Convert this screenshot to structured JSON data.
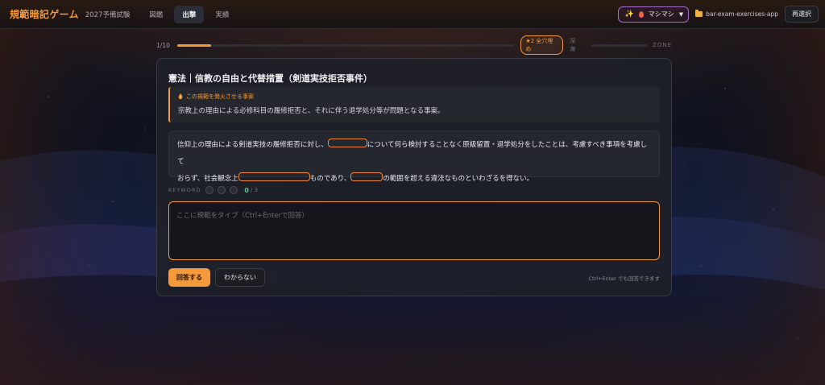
{
  "header": {
    "logo": "規範暗記ゲーム",
    "exam": "2027予備試験",
    "tabs": [
      {
        "label": "図鑑",
        "active": false
      },
      {
        "label": "出撃",
        "active": true
      },
      {
        "label": "実績",
        "active": false
      }
    ],
    "mode": "マシマシ",
    "repo": "bar-exam-exercises-app",
    "reselect": "再選択"
  },
  "progress": {
    "count": "1/10",
    "fraction": 0.1,
    "streak": "★2 全穴埋め",
    "depth": "深 海",
    "zone": "ZONE"
  },
  "question": {
    "title": "憲法｜信教の自由と代替措置（剣道実技拒否事件）",
    "facts_label": "この規範を発火させる事案",
    "facts_text": "宗教上の理由による必修科目の履修拒否と、それに伴う退学処分等が問題となる事案。",
    "segments": [
      "信仰上の理由による剣道実技の履修拒否に対し、",
      "について何ら検討することなく原級留置・退学処分をしたことは、考慮すべき事項を考慮して",
      "おらず、社会観念上",
      "ものであり、",
      "の範囲を超える違法なものといわざるを得ない。"
    ]
  },
  "keyword": {
    "label": "KEYWORD",
    "count": "0",
    "total": "/ 3"
  },
  "answer": {
    "placeholder": "ここに規範をタイプ（Ctrl+Enterで回答）",
    "value": ""
  },
  "actions": {
    "submit": "回答する",
    "unknown": "わからない",
    "hint": "Ctrl+Enter でも回答できます"
  },
  "colors": {
    "accent": "#f59a3a",
    "mode_border": "#a86bd0",
    "keyword_count": "#58c88a"
  }
}
